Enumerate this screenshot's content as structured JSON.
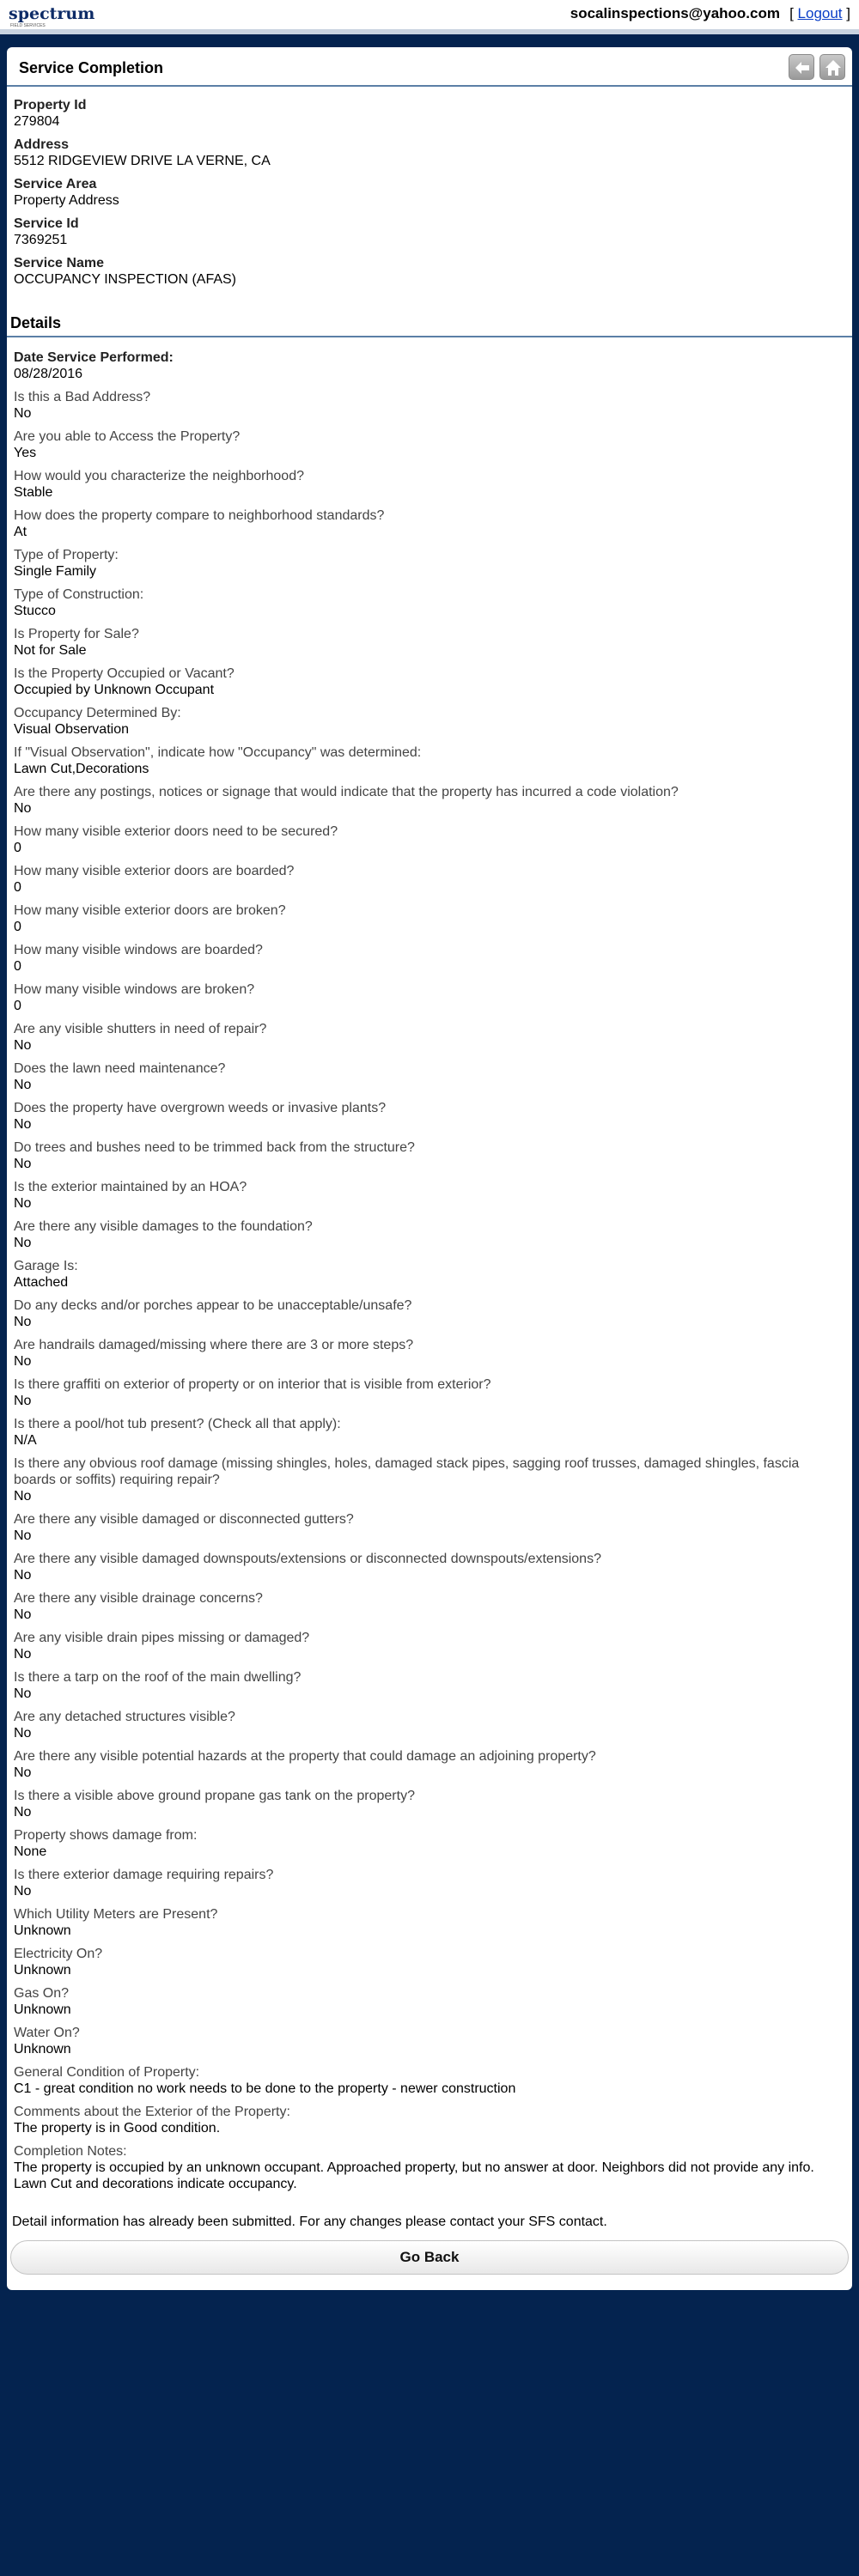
{
  "header": {
    "logo_text": "spectrum",
    "logo_sub": "FIELD SERVICES",
    "email": "socalinspections@yahoo.com",
    "logout_open": "[",
    "logout_label": "Logout",
    "logout_close": "]"
  },
  "panel": {
    "title": "Service Completion",
    "back_icon": "back-arrow-icon",
    "home_icon": "home-icon"
  },
  "summary": [
    {
      "label": "Property Id",
      "value": "279804"
    },
    {
      "label": "Address",
      "value": "5512 RIDGEVIEW DRIVE LA VERNE, CA"
    },
    {
      "label": "Service Area",
      "value": "Property Address"
    },
    {
      "label": "Service Id",
      "value": "7369251"
    },
    {
      "label": "Service Name",
      "value": "OCCUPANCY INSPECTION (AFAS)"
    }
  ],
  "details_title": "Details",
  "details": [
    {
      "label": "Date Service Performed:",
      "value": "08/28/2016"
    },
    {
      "label": "Is this a Bad Address?",
      "value": "No"
    },
    {
      "label": "Are you able to Access the Property?",
      "value": "Yes"
    },
    {
      "label": "How would you characterize the neighborhood?",
      "value": "Stable"
    },
    {
      "label": "How does the property compare to neighborhood standards?",
      "value": "At"
    },
    {
      "label": "Type of Property:",
      "value": "Single Family"
    },
    {
      "label": "Type of Construction:",
      "value": "Stucco"
    },
    {
      "label": "Is Property for Sale?",
      "value": "Not for Sale"
    },
    {
      "label": "Is the Property Occupied or Vacant?",
      "value": "Occupied by Unknown Occupant"
    },
    {
      "label": "Occupancy Determined By:",
      "value": "Visual Observation"
    },
    {
      "label": "If \"Visual Observation\", indicate how \"Occupancy\" was determined:",
      "value": "Lawn Cut,Decorations"
    },
    {
      "label": "Are there any postings, notices or signage that would indicate that the property has incurred a code violation?",
      "value": "No"
    },
    {
      "label": "How many visible exterior doors need to be secured?",
      "value": "0"
    },
    {
      "label": "How many visible exterior doors are boarded?",
      "value": "0"
    },
    {
      "label": "How many visible exterior doors are broken?",
      "value": "0"
    },
    {
      "label": "How many visible windows are boarded?",
      "value": "0"
    },
    {
      "label": "How many visible windows are broken?",
      "value": "0"
    },
    {
      "label": "Are any visible shutters in need of repair?",
      "value": "No"
    },
    {
      "label": "Does the lawn need maintenance?",
      "value": "No"
    },
    {
      "label": "Does the property have overgrown weeds or invasive plants?",
      "value": "No"
    },
    {
      "label": "Do trees and bushes need to be trimmed back from the structure?",
      "value": "No"
    },
    {
      "label": "Is the exterior maintained by an HOA?",
      "value": "No"
    },
    {
      "label": "Are there any visible damages to the foundation?",
      "value": "No"
    },
    {
      "label": "Garage Is:",
      "value": "Attached"
    },
    {
      "label": "Do any decks and/or porches appear to be unacceptable/unsafe?",
      "value": "No"
    },
    {
      "label": "Are handrails damaged/missing where there are 3 or more steps?",
      "value": "No"
    },
    {
      "label": "Is there graffiti on exterior of property or on interior that is visible from exterior?",
      "value": "No"
    },
    {
      "label": "Is there a pool/hot tub present? (Check all that apply):",
      "value": "N/A"
    },
    {
      "label": "Is there any obvious roof damage (missing shingles, holes, damaged stack pipes, sagging roof trusses, damaged shingles, fascia boards or soffits) requiring repair?",
      "value": "No"
    },
    {
      "label": "Are there any visible damaged or disconnected gutters?",
      "value": "No"
    },
    {
      "label": "Are there any visible damaged downspouts/extensions or disconnected downspouts/extensions?",
      "value": "No"
    },
    {
      "label": "Are there any visible drainage concerns?",
      "value": "No"
    },
    {
      "label": "Are any visible drain pipes missing or damaged?",
      "value": "No"
    },
    {
      "label": "Is there a tarp on the roof of the main dwelling?",
      "value": "No"
    },
    {
      "label": "Are any detached structures visible?",
      "value": "No"
    },
    {
      "label": "Are there any visible potential hazards at the property that could damage an adjoining property?",
      "value": "No"
    },
    {
      "label": "Is there a visible above ground propane gas tank on the property?",
      "value": "No"
    },
    {
      "label": "Property shows damage from:",
      "value": "None"
    },
    {
      "label": "Is there exterior damage requiring repairs?",
      "value": "No"
    },
    {
      "label": "Which Utility Meters are Present?",
      "value": "Unknown"
    },
    {
      "label": "Electricity On?",
      "value": "Unknown"
    },
    {
      "label": "Gas On?",
      "value": "Unknown"
    },
    {
      "label": "Water On?",
      "value": "Unknown"
    },
    {
      "label": "General Condition of Property:",
      "value": "C1 - great condition no work needs to be done to the property - newer construction"
    },
    {
      "label": "Comments about the Exterior of the Property:",
      "value": "The property is in Good condition."
    },
    {
      "label": "Completion Notes:",
      "value": "The property is occupied by an unknown occupant. Approached property, but no answer at door. Neighbors did not provide any info. Lawn Cut and decorations indicate occupancy."
    }
  ],
  "submitted_note": "Detail information has already been submitted. For any changes please contact your SFS contact.",
  "go_back_label": "Go Back"
}
